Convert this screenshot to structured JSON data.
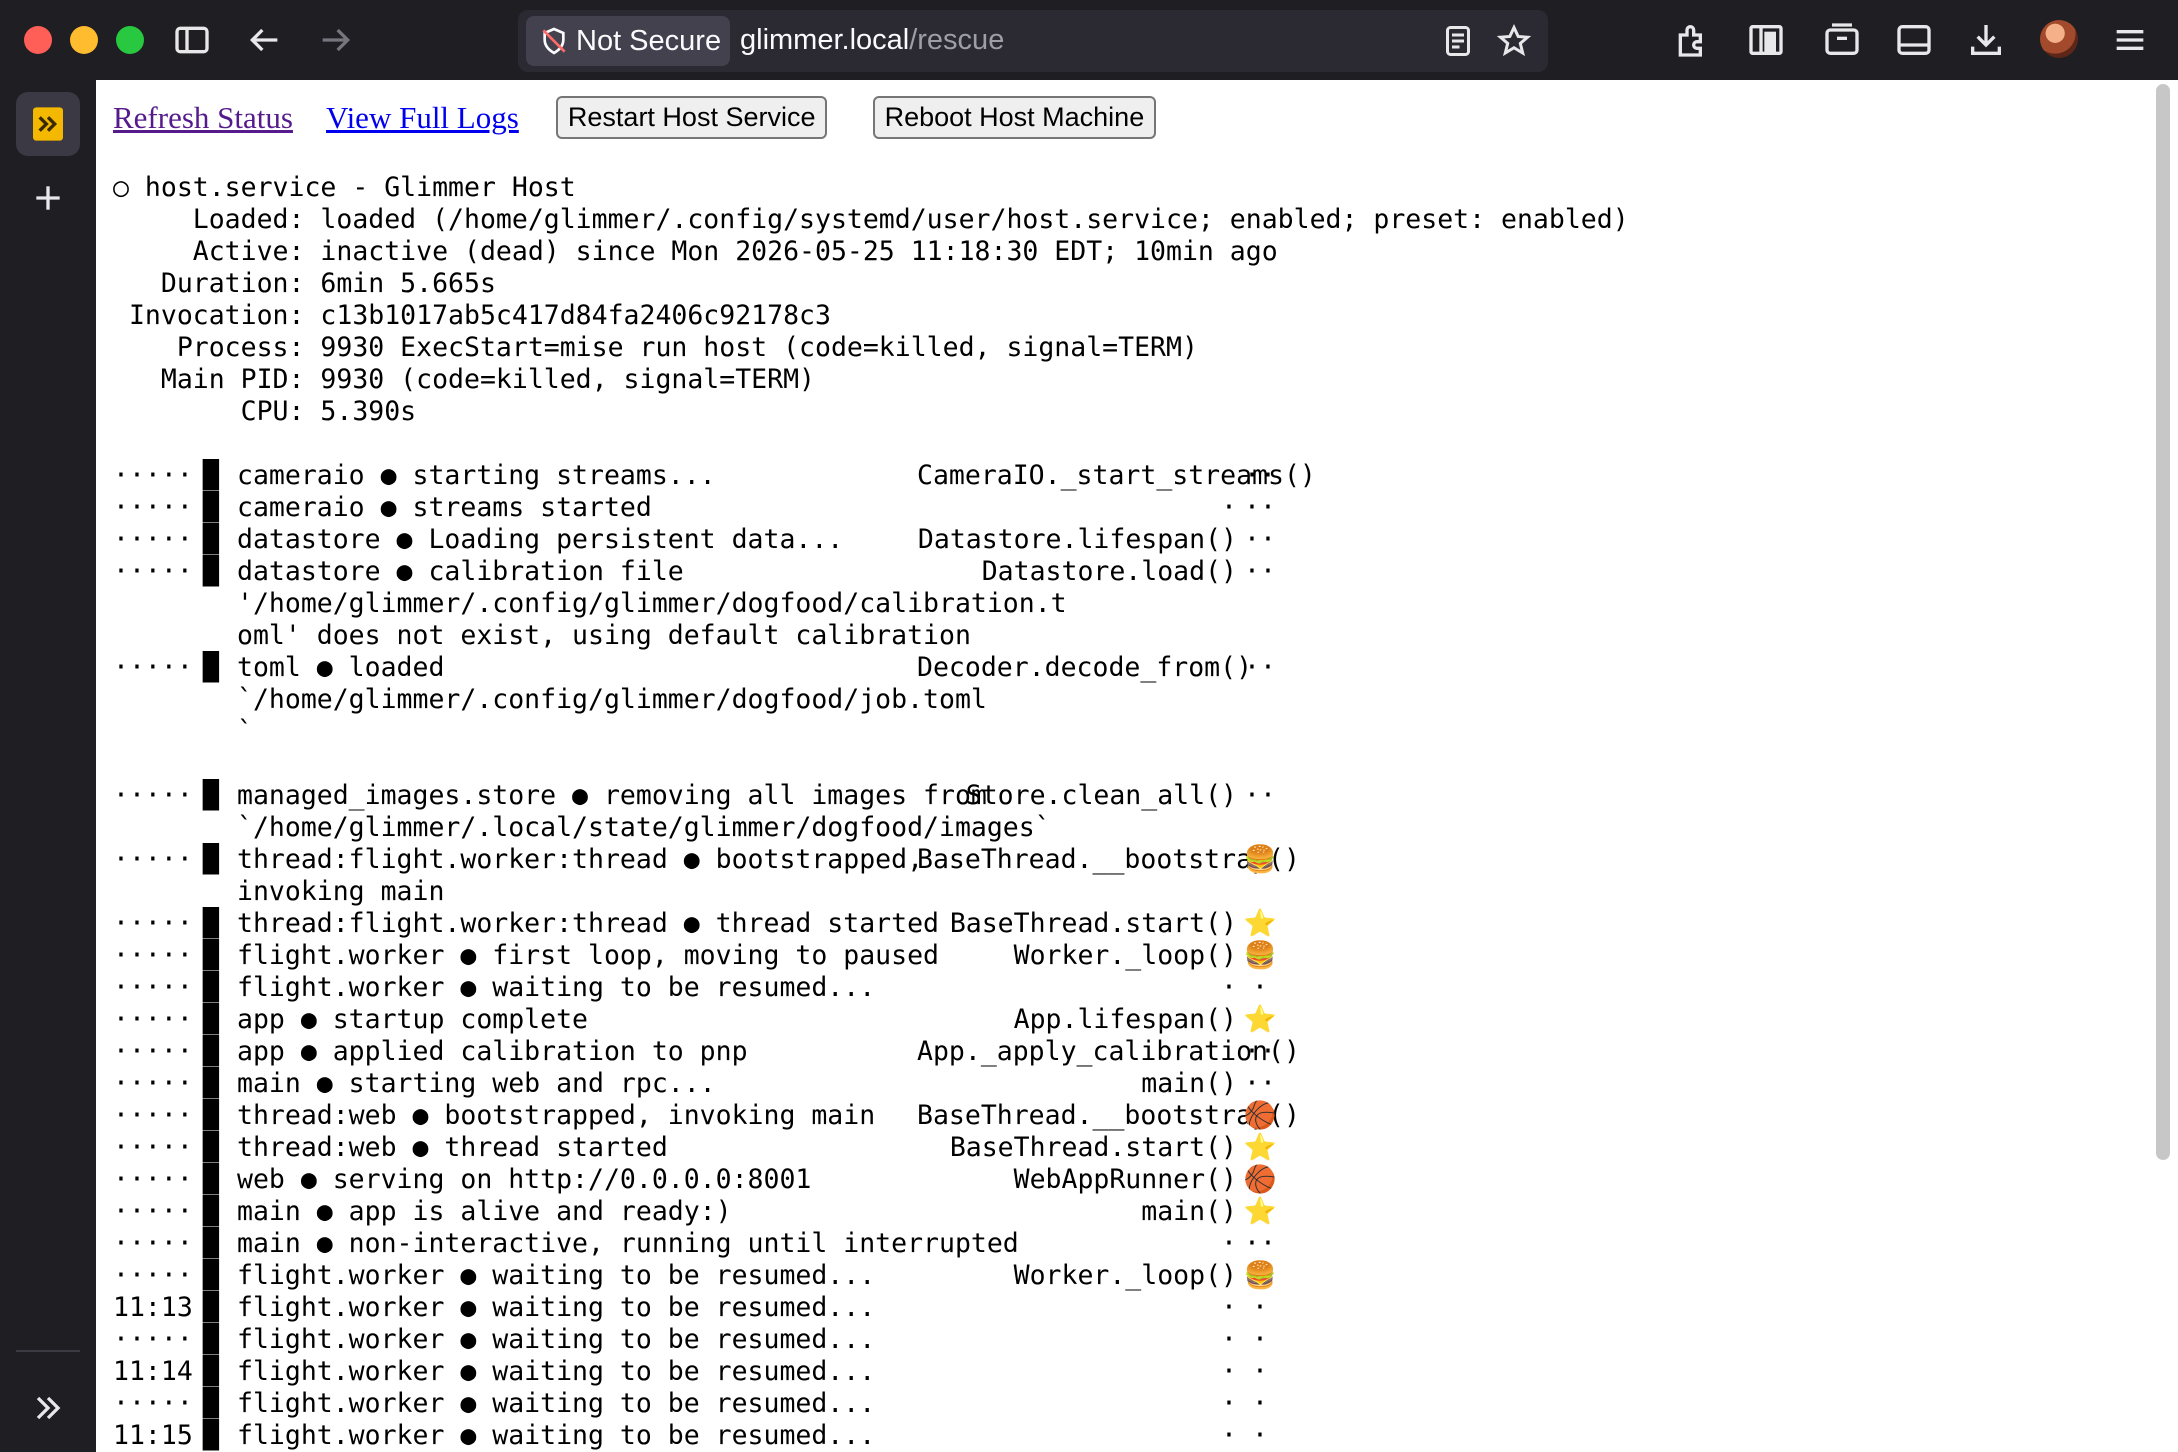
{
  "browser": {
    "security_label": "Not Secure",
    "url_host": "glimmer.local",
    "url_path": "/rescue"
  },
  "actions": {
    "refresh": "Refresh Status",
    "logs": "View Full Logs",
    "restart": "Restart Host Service",
    "reboot": "Reboot Host Machine"
  },
  "status_lines": [
    "○ host.service - Glimmer Host",
    "     Loaded: loaded (/home/glimmer/.config/systemd/user/host.service; enabled; preset: enabled)",
    "     Active: inactive (dead) since Mon 2026-05-25 11:18:30 EDT; 10min ago",
    "   Duration: 6min 5.665s",
    " Invocation: c13b1017ab5c417d84fa2406c92178c3",
    "    Process: 9930 ExecStart=mise run host (code=killed, signal=TERM)",
    "   Main PID: 9930 (code=killed, signal=TERM)",
    "        CPU: 5.390s"
  ],
  "log_rows": [
    {
      "time": "·····",
      "msg": "cameraio ● starting streams...",
      "fn": "CameraIO._start_streams()",
      "lvl": "··"
    },
    {
      "time": "·····",
      "msg": "cameraio ● streams started",
      "fn": "·",
      "lvl": "··"
    },
    {
      "time": "·····",
      "msg": "datastore ● Loading persistent data...",
      "fn": "Datastore.lifespan()",
      "lvl": "··"
    },
    {
      "time": "·····",
      "msg": "datastore ● calibration file\n'/home/glimmer/.config/glimmer/dogfood/calibration.t\noml' does not exist, using default calibration",
      "fn": "Datastore.load()",
      "lvl": "··"
    },
    {
      "time": "·····",
      "msg": "toml ● loaded\n`/home/glimmer/.config/glimmer/dogfood/job.toml\n`",
      "fn": "Decoder.decode_from()",
      "lvl": "··"
    },
    {
      "time": "",
      "msg": "",
      "fn": "",
      "lvl": ""
    },
    {
      "time": "·····",
      "msg": "managed_images.store ● removing all images from\n`/home/glimmer/.local/state/glimmer/dogfood/images`",
      "fn": "Store.clean_all()",
      "lvl": "··"
    },
    {
      "time": "·····",
      "msg": "thread:flight.worker:thread ● bootstrapped,\ninvoking main",
      "fn": "BaseThread.__bootstrap()",
      "lvl": "🍔"
    },
    {
      "time": "·····",
      "msg": "thread:flight.worker:thread ● thread started",
      "fn": "BaseThread.start()",
      "lvl": "⭐"
    },
    {
      "time": "·····",
      "msg": "flight.worker ● first loop, moving to paused",
      "fn": "Worker._loop()",
      "lvl": "🍔"
    },
    {
      "time": "·····",
      "msg": "flight.worker ● waiting to be resumed...",
      "fn": "·",
      "lvl": "·"
    },
    {
      "time": "·····",
      "msg": "app ● startup complete",
      "fn": "App.lifespan()",
      "lvl": "⭐"
    },
    {
      "time": "·····",
      "msg": "app ● applied calibration to pnp",
      "fn": "App._apply_calibration()",
      "lvl": "··"
    },
    {
      "time": "·····",
      "msg": "main ● starting web and rpc...",
      "fn": "main()",
      "lvl": "··"
    },
    {
      "time": "·····",
      "msg": "thread:web ● bootstrapped, invoking main",
      "fn": "BaseThread.__bootstrap()",
      "lvl": "🏀"
    },
    {
      "time": "·····",
      "msg": "thread:web ● thread started",
      "fn": "BaseThread.start()",
      "lvl": "⭐"
    },
    {
      "time": "·····",
      "msg": "web ● serving on http://0.0.0.0:8001",
      "fn": "WebAppRunner()",
      "lvl": "🏀"
    },
    {
      "time": "·····",
      "msg": "main ● app is alive and ready:)",
      "fn": "main()",
      "lvl": "⭐"
    },
    {
      "time": "·····",
      "msg": "main ● non-interactive, running until interrupted",
      "fn": "·",
      "lvl": "··"
    },
    {
      "time": "·····",
      "msg": "flight.worker ● waiting to be resumed...",
      "fn": "Worker._loop()",
      "lvl": "🍔"
    },
    {
      "time": "11:13",
      "msg": "flight.worker ● waiting to be resumed...",
      "fn": "·",
      "lvl": "·"
    },
    {
      "time": "·····",
      "msg": "flight.worker ● waiting to be resumed...",
      "fn": "·",
      "lvl": "·"
    },
    {
      "time": "11:14",
      "msg": "flight.worker ● waiting to be resumed...",
      "fn": "·",
      "lvl": "·"
    },
    {
      "time": "·····",
      "msg": "flight.worker ● waiting to be resumed...",
      "fn": "·",
      "lvl": "·"
    },
    {
      "time": "11:15",
      "msg": "flight.worker ● waiting to be resumed...",
      "fn": "·",
      "lvl": "·"
    }
  ],
  "icons": {
    "sidebar_active": "extension-app-icon",
    "sidebar_add": "plus-icon",
    "sidebar_expand": "double-chevron-right-icon"
  }
}
